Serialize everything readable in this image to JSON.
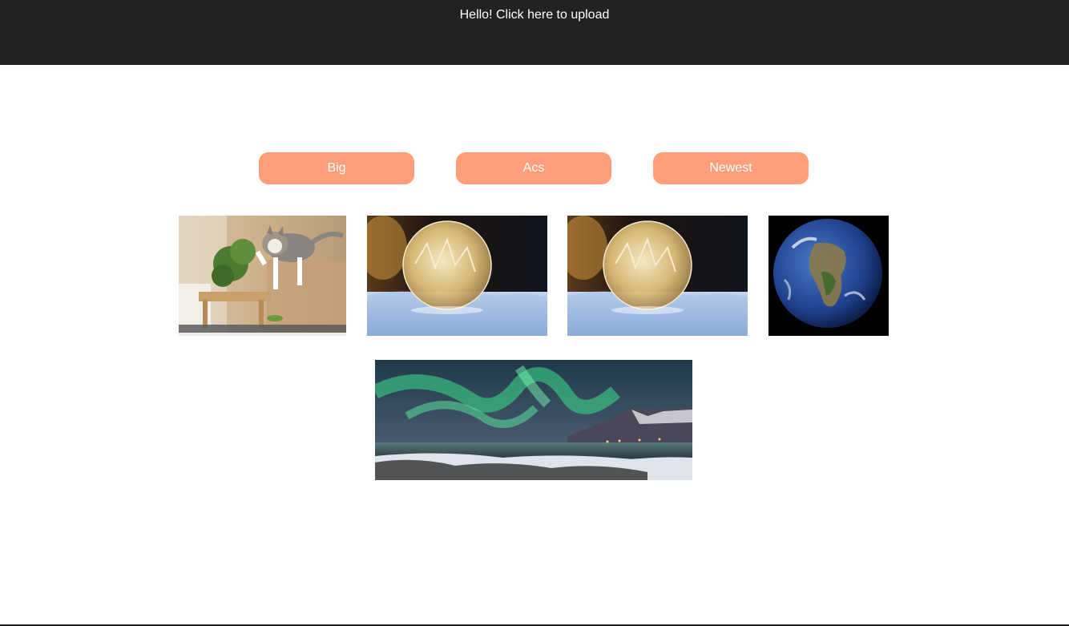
{
  "header": {
    "upload_link": "Hello! Click here to upload"
  },
  "sort_buttons": {
    "big": "Big",
    "acs": "Acs",
    "newest": "Newest"
  },
  "gallery": {
    "images": [
      {
        "subject": "jumping kitten"
      },
      {
        "subject": "frozen soap bubble"
      },
      {
        "subject": "frozen soap bubble"
      },
      {
        "subject": "earth from space"
      },
      {
        "subject": "northern lights over coast"
      }
    ]
  },
  "colors": {
    "header_bg": "#222222",
    "button_bg": "#ff9e78",
    "button_text": "#ffffff"
  }
}
